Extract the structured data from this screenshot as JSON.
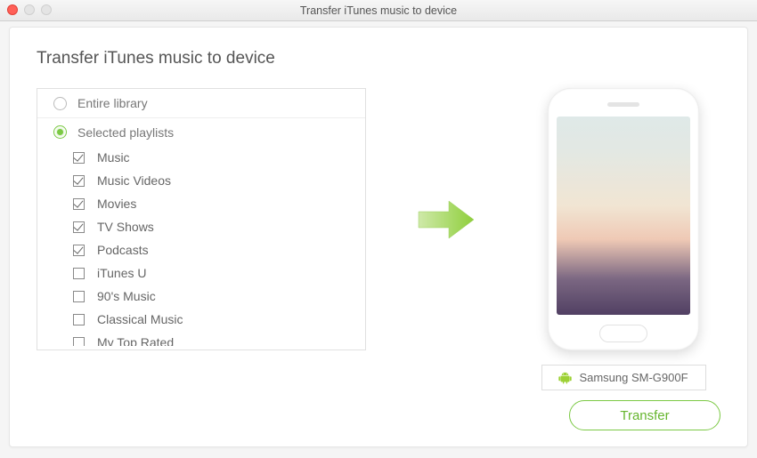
{
  "window": {
    "title": "Transfer iTunes music to device"
  },
  "page": {
    "heading": "Transfer iTunes music to device"
  },
  "options": {
    "entire": {
      "label": "Entire library",
      "selected": false
    },
    "selected": {
      "label": "Selected playlists",
      "selected": true
    }
  },
  "playlists": [
    {
      "label": "Music",
      "checked": true
    },
    {
      "label": "Music Videos",
      "checked": true
    },
    {
      "label": "Movies",
      "checked": true
    },
    {
      "label": "TV Shows",
      "checked": true
    },
    {
      "label": "Podcasts",
      "checked": true
    },
    {
      "label": "iTunes U",
      "checked": false
    },
    {
      "label": "90's Music",
      "checked": false
    },
    {
      "label": "Classical Music",
      "checked": false
    },
    {
      "label": "My Top Rated",
      "checked": false
    }
  ],
  "device": {
    "name": "Samsung SM-G900F",
    "platform": "android"
  },
  "actions": {
    "transfer": "Transfer"
  },
  "colors": {
    "accent": "#7bc944"
  }
}
